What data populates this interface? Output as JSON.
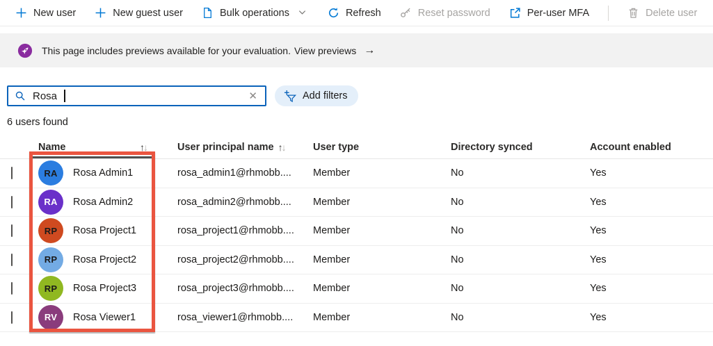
{
  "toolbar": {
    "items": [
      {
        "label": "New user",
        "icon": "plus-icon",
        "enabled": true,
        "dropdown": false
      },
      {
        "label": "New guest user",
        "icon": "plus-icon",
        "enabled": true,
        "dropdown": false
      },
      {
        "label": "Bulk operations",
        "icon": "document-icon",
        "enabled": true,
        "dropdown": true
      },
      {
        "label": "Refresh",
        "icon": "refresh-icon",
        "enabled": true,
        "dropdown": false
      },
      {
        "label": "Reset password",
        "icon": "key-icon",
        "enabled": false,
        "dropdown": false
      },
      {
        "label": "Per-user MFA",
        "icon": "external-link-icon",
        "enabled": true,
        "dropdown": false
      },
      {
        "label": "Delete user",
        "icon": "trash-icon",
        "enabled": false,
        "dropdown": false
      }
    ]
  },
  "banner": {
    "icon": "preview-rocket-icon",
    "message": "This page includes previews available for your evaluation.",
    "link_text": "View previews",
    "arrow": "→"
  },
  "search": {
    "value": "Rosa",
    "clear_glyph": "✕"
  },
  "filters": {
    "add_label": "Add filters"
  },
  "status": {
    "results": "6 users found"
  },
  "table": {
    "sort_up": "↑",
    "sort_down": "↓",
    "columns": [
      {
        "label": "Name",
        "sortable": true
      },
      {
        "label": "User principal name",
        "sortable": true
      },
      {
        "label": "User type",
        "sortable": false
      },
      {
        "label": "Directory synced",
        "sortable": false
      },
      {
        "label": "Account enabled",
        "sortable": false
      }
    ],
    "rows": [
      {
        "initials": "RA",
        "avatar_color": "#2b7de0",
        "initials_color": "#1b1a19",
        "name": "Rosa Admin1",
        "upn": "rosa_admin1@rhmobb....",
        "user_type": "Member",
        "directory_synced": "No",
        "account_enabled": "Yes"
      },
      {
        "initials": "RA",
        "avatar_color": "#6a30c9",
        "initials_color": "#ffffff",
        "name": "Rosa Admin2",
        "upn": "rosa_admin2@rhmobb....",
        "user_type": "Member",
        "directory_synced": "No",
        "account_enabled": "Yes"
      },
      {
        "initials": "RP",
        "avatar_color": "#cf4a20",
        "initials_color": "#1b1a19",
        "name": "Rosa Project1",
        "upn": "rosa_project1@rhmobb....",
        "user_type": "Member",
        "directory_synced": "No",
        "account_enabled": "Yes"
      },
      {
        "initials": "RP",
        "avatar_color": "#73abe4",
        "initials_color": "#1b1a19",
        "name": "Rosa Project2",
        "upn": "rosa_project2@rhmobb....",
        "user_type": "Member",
        "directory_synced": "No",
        "account_enabled": "Yes"
      },
      {
        "initials": "RP",
        "avatar_color": "#90b821",
        "initials_color": "#1b1a19",
        "name": "Rosa Project3",
        "upn": "rosa_project3@rhmobb....",
        "user_type": "Member",
        "directory_synced": "No",
        "account_enabled": "Yes"
      },
      {
        "initials": "RV",
        "avatar_color": "#8a3c7c",
        "initials_color": "#ffffff",
        "name": "Rosa Viewer1",
        "upn": "rosa_viewer1@rhmobb....",
        "user_type": "Member",
        "directory_synced": "No",
        "account_enabled": "Yes"
      }
    ]
  },
  "annotation": {
    "color": "#ea5540"
  }
}
